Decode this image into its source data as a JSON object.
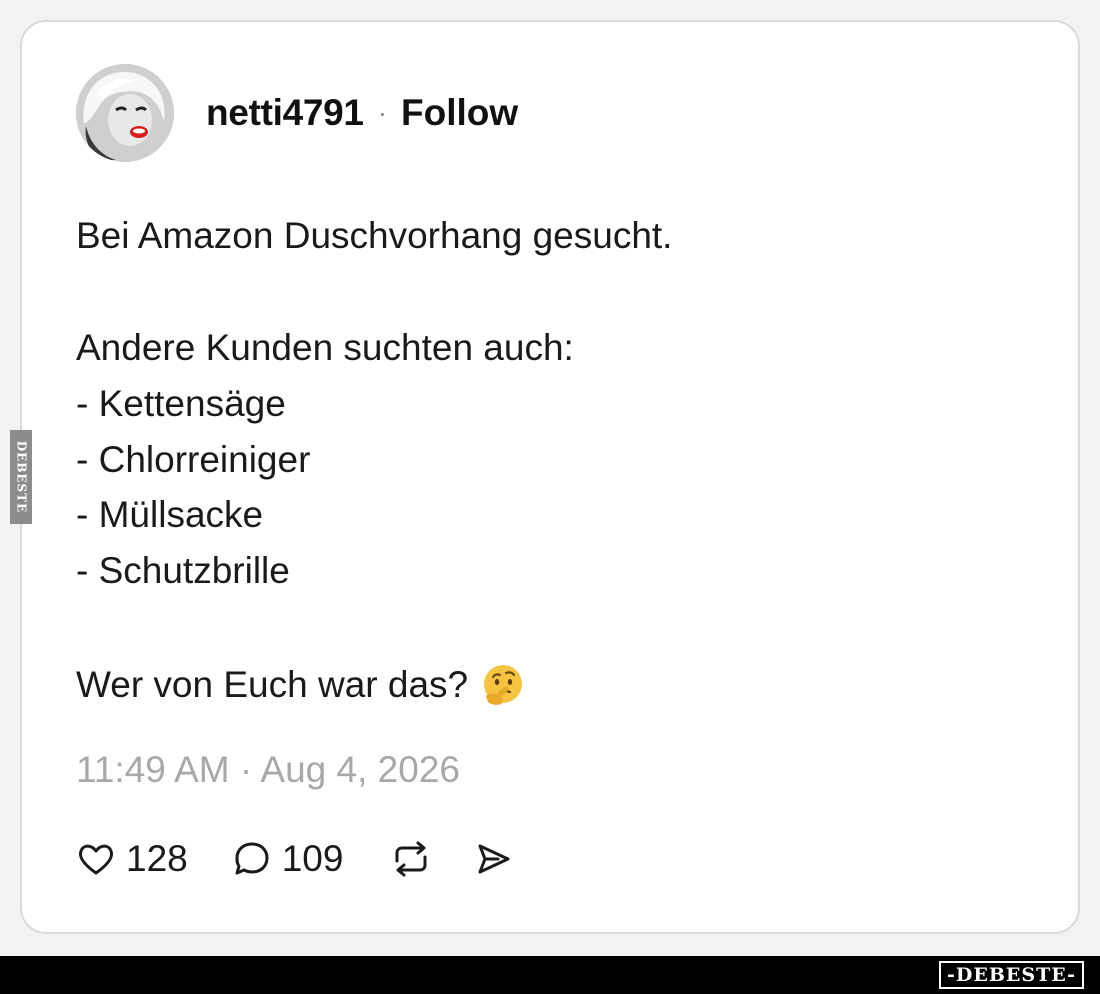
{
  "post": {
    "username": "netti4791",
    "separator": "·",
    "follow_label": "Follow",
    "lines": {
      "intro": "Bei Amazon Duschvorhang gesucht.",
      "others": "Andere Kunden suchten auch:",
      "items": [
        "- Kettensäge",
        "- Chlorreiniger",
        "- Müllsacke",
        "- Schutzbrille"
      ],
      "question": "Wer von Euch war das?"
    },
    "emoji": "thinking-face",
    "timestamp": "11:49 AM · Aug 4, 2026",
    "likes": "128",
    "replies": "109"
  },
  "watermark": {
    "footer": "-DEBESTE-",
    "side": "DEBESTE"
  },
  "colors": {
    "background": "#f2f2f2",
    "card": "#ffffff",
    "text": "#1a1a1a",
    "muted": "#a8a8a8",
    "footer": "#000000"
  }
}
